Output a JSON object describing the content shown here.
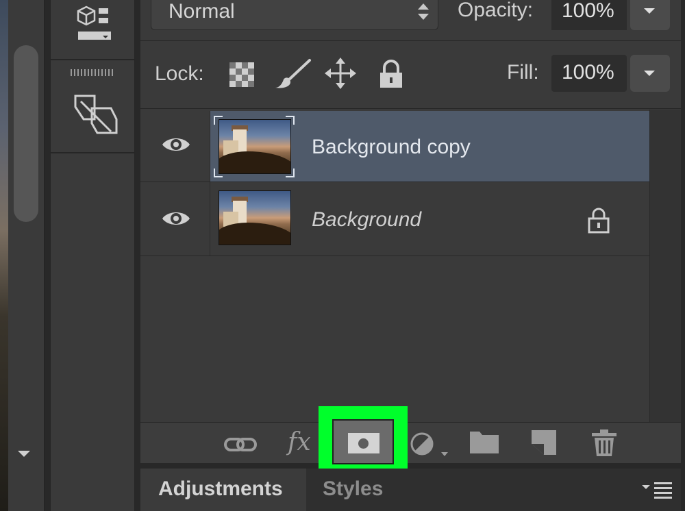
{
  "layers_panel": {
    "blend_mode": "Normal",
    "opacity_label": "Opacity:",
    "opacity_value": "100%",
    "lock_label": "Lock:",
    "fill_label": "Fill:",
    "fill_value": "100%",
    "layers": [
      {
        "name": "Background copy",
        "selected": true,
        "locked": false,
        "visible": true
      },
      {
        "name": "Background",
        "selected": false,
        "locked": true,
        "visible": true
      }
    ],
    "bottom_icons": [
      "link-layers-icon",
      "fx-icon",
      "add-layer-mask-icon",
      "adjustment-layer-icon",
      "new-group-icon",
      "new-layer-icon",
      "trash-icon"
    ],
    "fx_glyph": "fx",
    "highlight_color": "#00ff2b",
    "selected_row_color": "#4f5a6a"
  },
  "tabs": {
    "adjustments_label": "Adjustments",
    "styles_label": "Styles"
  }
}
